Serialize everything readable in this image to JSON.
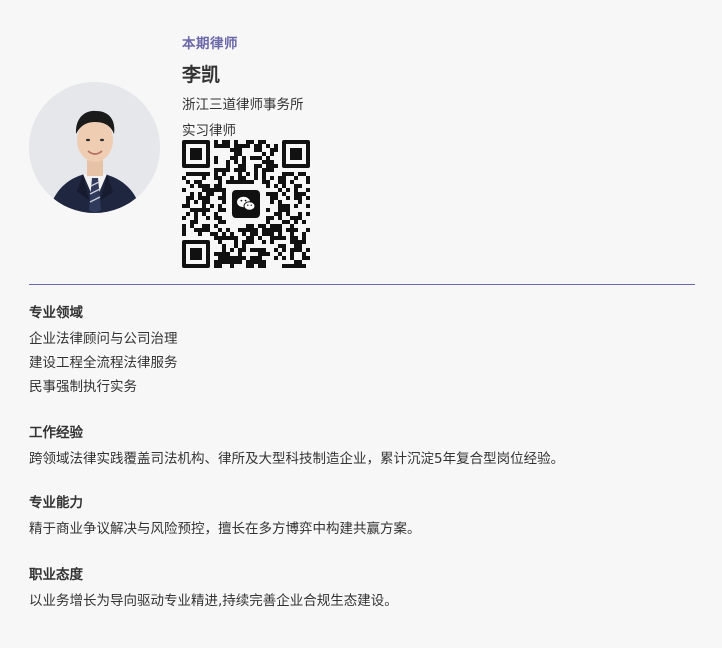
{
  "profile": {
    "issue_label": "本期律师",
    "name": "李凯",
    "firm": "浙江三道律师事务所",
    "role": "实习律师"
  },
  "icons": {
    "qr_center": "wechat-icon"
  },
  "colors": {
    "accent": "#6b68a8",
    "text": "#333333",
    "background": "#f7f7f7"
  },
  "sections": {
    "expertise": {
      "title": "专业领域",
      "lines": [
        "企业法律顾问与公司治理",
        "建设工程全流程法律服务",
        "民事强制执行实务"
      ]
    },
    "experience": {
      "title": "工作经验",
      "lines": [
        "跨领域法律实践覆盖司法机构、律所及大型科技制造企业，累计沉淀5年复合型岗位经验。"
      ]
    },
    "ability": {
      "title": "专业能力",
      "lines": [
        "精于商业争议解决与风险预控，擅长在多方博弈中构建共赢方案。"
      ]
    },
    "attitude": {
      "title": "职业态度",
      "lines": [
        "以业务增长为导向驱动专业精进,持续完善企业合规生态建设。"
      ]
    }
  }
}
